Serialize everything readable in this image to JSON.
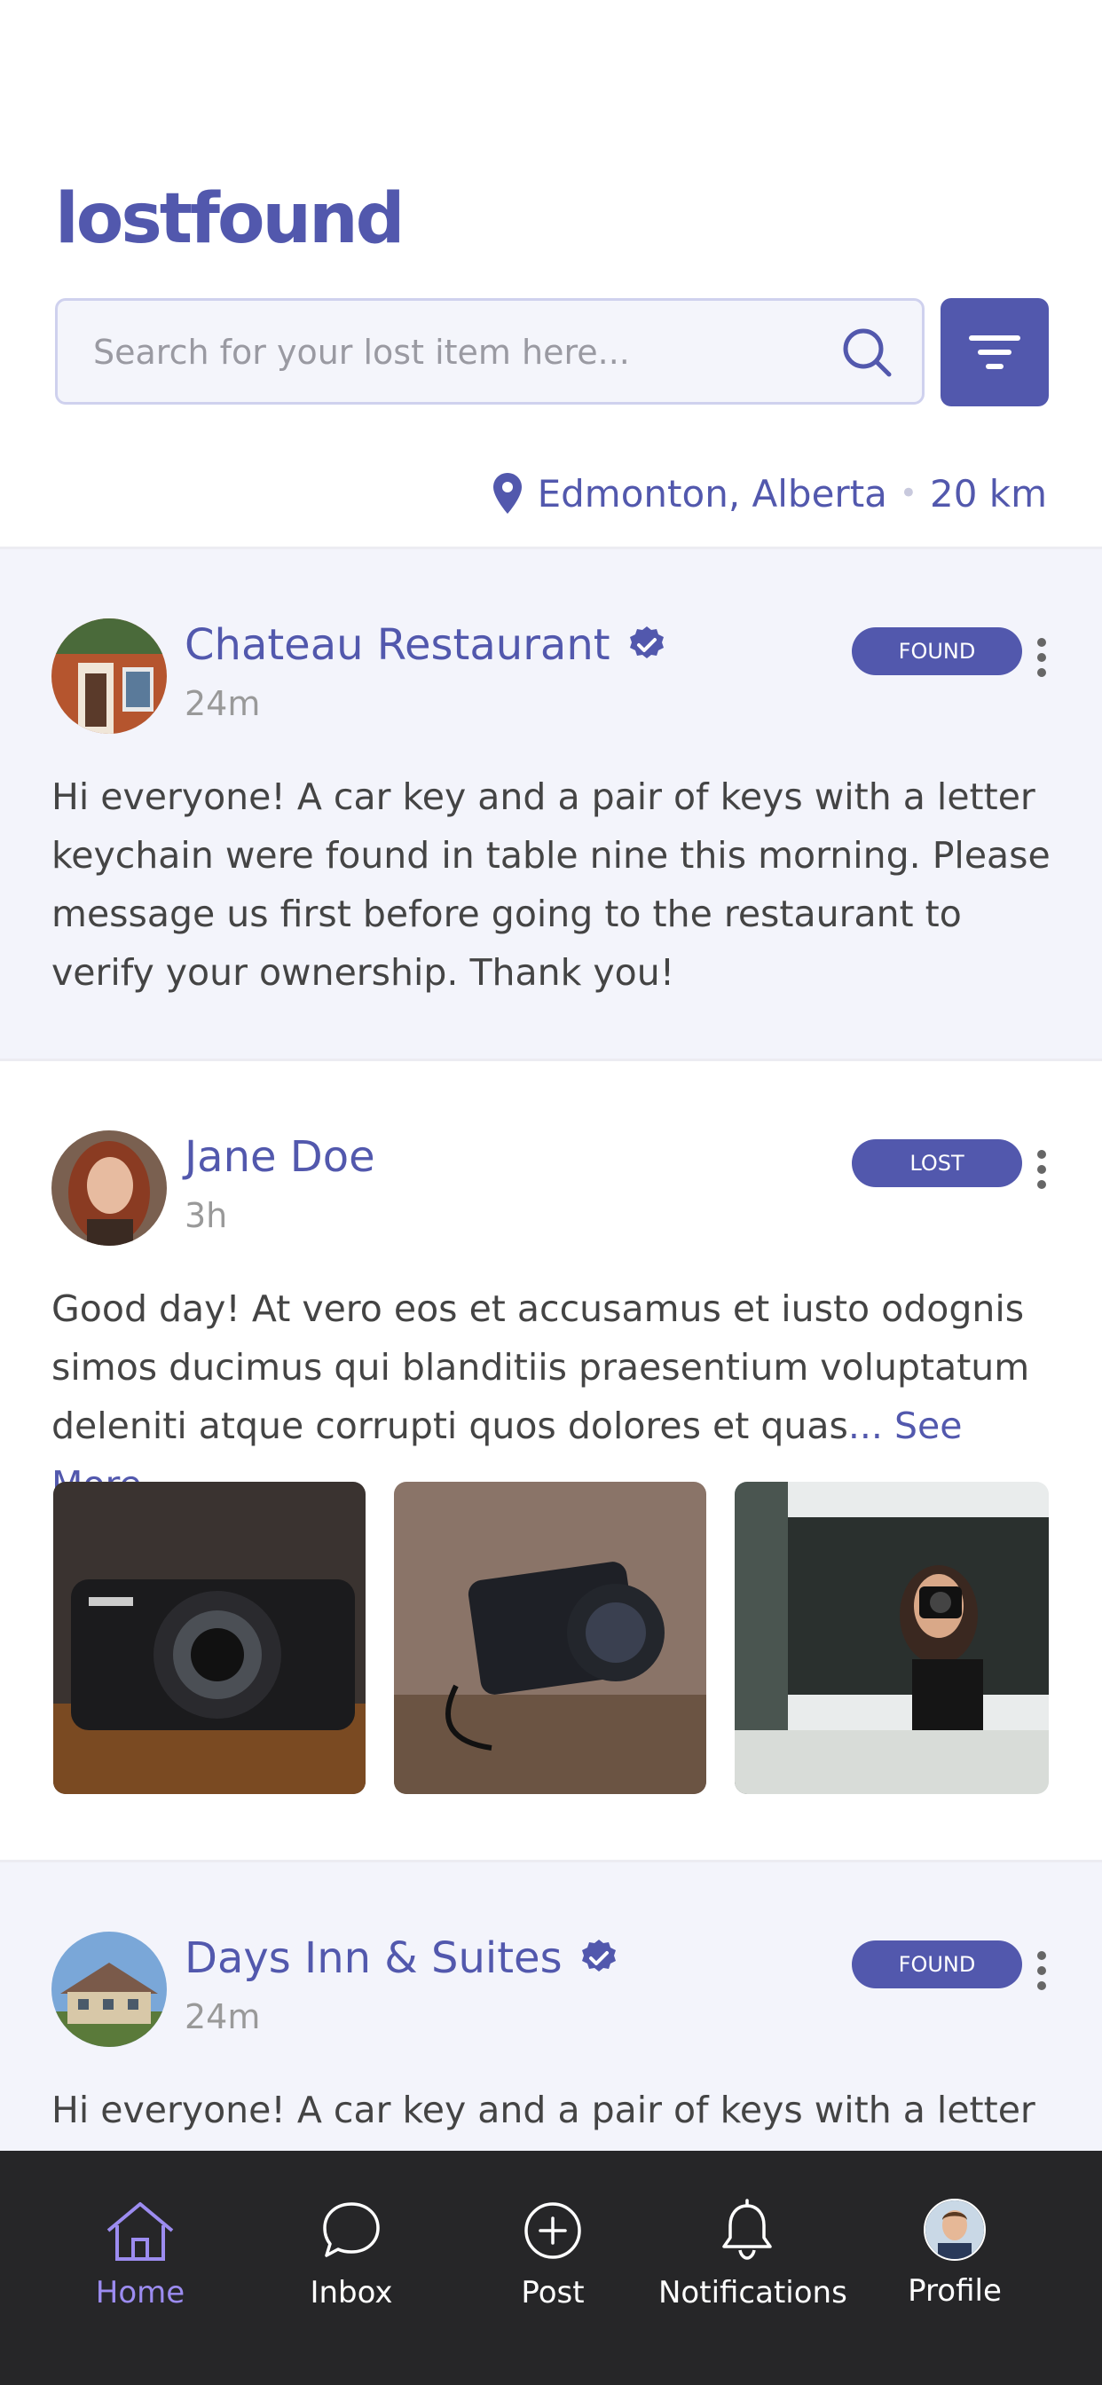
{
  "app": {
    "logo_text": "lostfound",
    "accent": "#5258ad"
  },
  "search": {
    "placeholder": "Search for your lost item here..."
  },
  "location": {
    "city": "Edmonton, Alberta",
    "separator": "•",
    "radius": "20 km"
  },
  "posts": [
    {
      "author": "Chateau Restaurant",
      "verified": true,
      "time": "24m",
      "badge": "FOUND",
      "text": "Hi everyone! A car key and a pair of keys with a letter keychain were found in table nine this morning. Please message us first before going to the restaurant to verify your ownership. Thank you!"
    },
    {
      "author": "Jane Doe",
      "verified": false,
      "time": "3h",
      "badge": "LOST",
      "text": "Good day! At vero eos et accusamus et iusto odognis simos ducimus qui blanditiis praesentium voluptatum deleniti atque corrupti quos dolores et quas",
      "see_more": "... See More",
      "photos": [
        "camera-photo",
        "camera-photo",
        "woman-with-camera-photo"
      ]
    },
    {
      "author": "Days Inn & Suites",
      "verified": true,
      "time": "24m",
      "badge": "FOUND",
      "text": "Hi everyone! A car key and a pair of keys with a letter"
    }
  ],
  "tabbar": {
    "items": [
      {
        "label": "Home",
        "icon": "home-icon",
        "active": true
      },
      {
        "label": "Inbox",
        "icon": "chat-bubble-icon",
        "active": false
      },
      {
        "label": "Post",
        "icon": "plus-circle-icon",
        "active": false
      },
      {
        "label": "Notifications",
        "icon": "bell-icon",
        "active": false
      },
      {
        "label": "Profile",
        "icon": "avatar",
        "active": false
      }
    ]
  }
}
